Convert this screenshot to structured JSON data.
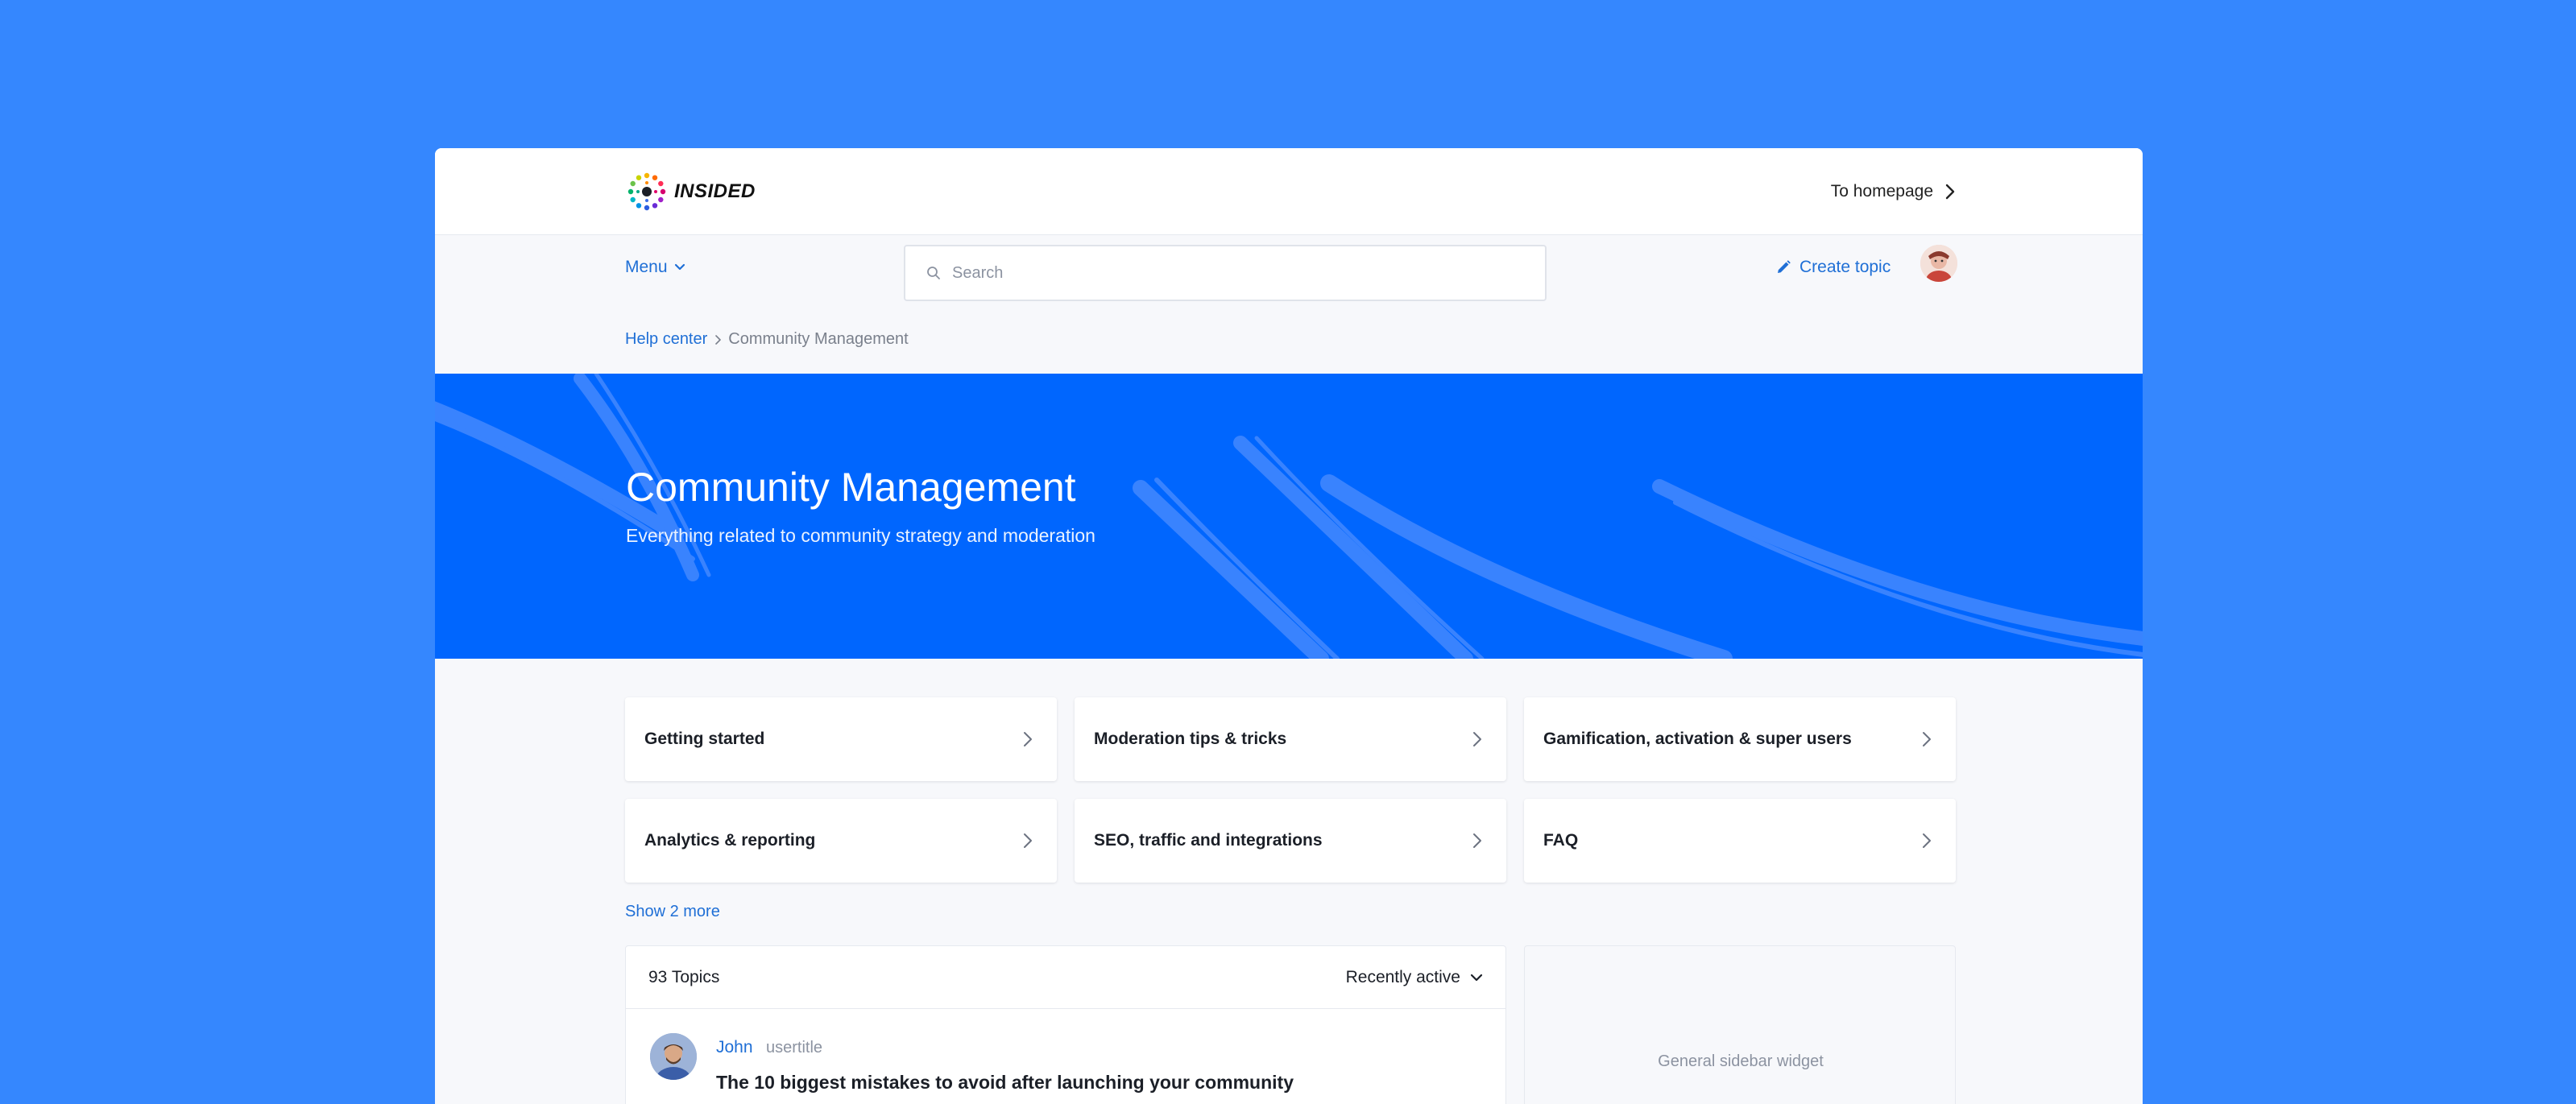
{
  "header": {
    "brand": "INSIDED",
    "to_homepage": "To homepage"
  },
  "nav": {
    "menu_label": "Menu",
    "search_placeholder": "Search",
    "create_topic": "Create topic"
  },
  "breadcrumb": {
    "root": "Help center",
    "current": "Community Management"
  },
  "hero": {
    "title": "Community Management",
    "subtitle": "Everything related to community strategy and moderation"
  },
  "categories": [
    {
      "label": "Getting started"
    },
    {
      "label": "Moderation tips & tricks"
    },
    {
      "label": "Gamification, activation & super users"
    },
    {
      "label": "Analytics & reporting"
    },
    {
      "label": "SEO, traffic and integrations"
    },
    {
      "label": "FAQ"
    }
  ],
  "show_more": "Show 2 more",
  "topics": {
    "count": "93 Topics",
    "sort_label": "Recently active",
    "items": [
      {
        "author": "John",
        "usertitle": "usertitle",
        "title": "The 10 biggest mistakes to avoid after launching your community"
      }
    ]
  },
  "sidebar": {
    "widget_label": "General sidebar widget"
  },
  "colors": {
    "page_bg": "#3587fe",
    "hero_bg": "#0066fe",
    "link": "#1f6fd6"
  }
}
